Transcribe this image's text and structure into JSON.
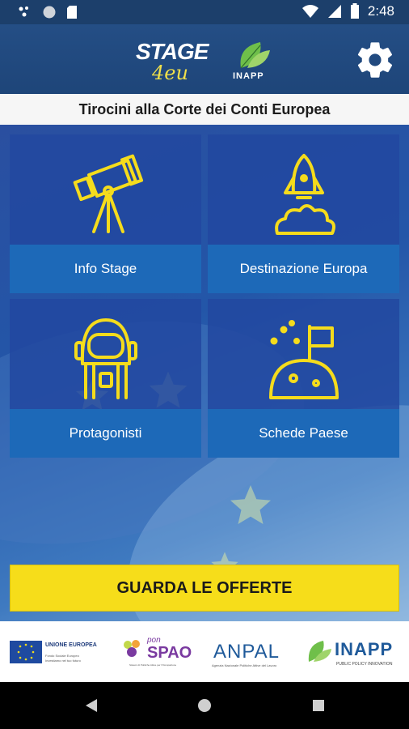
{
  "status_bar": {
    "time": "2:48"
  },
  "header": {
    "logo_line1": "STAGE",
    "logo_line2": "4eu",
    "partner_logo": "INAPP",
    "settings_icon": "gear-icon"
  },
  "subtitle": "Tirocini alla Corte dei Conti Europea",
  "tiles": [
    {
      "label": "Info Stage",
      "icon": "telescope-icon"
    },
    {
      "label": "Destinazione Europa",
      "icon": "rocket-icon"
    },
    {
      "label": "Protagonisti",
      "icon": "astronaut-icon"
    },
    {
      "label": "Schede Paese",
      "icon": "planet-flag-icon"
    }
  ],
  "cta": {
    "label": "GUARDA LE OFFERTE"
  },
  "footer": {
    "logos": {
      "ue_title": "UNIONE EUROPEA",
      "ue_sub1": "Fondo Sociale Europeo",
      "ue_sub2": "Investiamo nel tuo futuro",
      "pon_top": "pon",
      "pon_main": "SPAO",
      "pon_sub": "Sistemi di Politiche Attive per l'Occupazione",
      "anpal_main": "ANPAL",
      "anpal_sub": "Agenzia Nazionale Politiche Attive del Lavoro",
      "inapp_main": "INAPP",
      "inapp_sub": "PUBLIC POLICY INNOVATION"
    }
  },
  "colors": {
    "accent_yellow": "#f6dd1a",
    "header_blue": "#1e4579",
    "tile_label_blue": "#1d69b8"
  }
}
